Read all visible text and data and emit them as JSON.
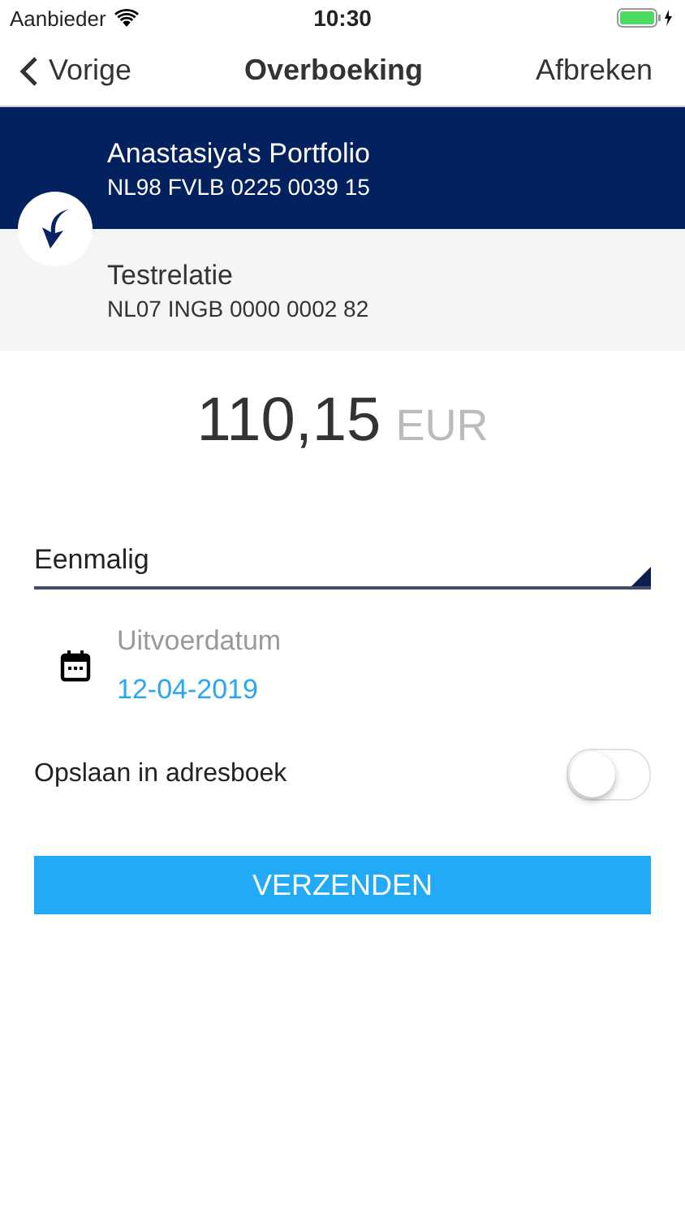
{
  "status_bar": {
    "carrier": "Aanbieder",
    "time": "10:30"
  },
  "nav": {
    "back": "Vorige",
    "title": "Overboeking",
    "cancel": "Afbreken"
  },
  "from_account": {
    "name": "Anastasiya's Portfolio",
    "iban": "NL98 FVLB 0225 0039 15"
  },
  "to_account": {
    "name": "Testrelatie",
    "iban": "NL07 INGB 0000 0002 82"
  },
  "amount": {
    "value": "110,15",
    "currency": "EUR"
  },
  "frequency": {
    "value": "Eenmalig"
  },
  "execution_date": {
    "label": "Uitvoerdatum",
    "value": "12-04-2019"
  },
  "save_to_address_book": {
    "label": "Opslaan in adresboek",
    "on": false
  },
  "submit_button": "VERZENDEN"
}
